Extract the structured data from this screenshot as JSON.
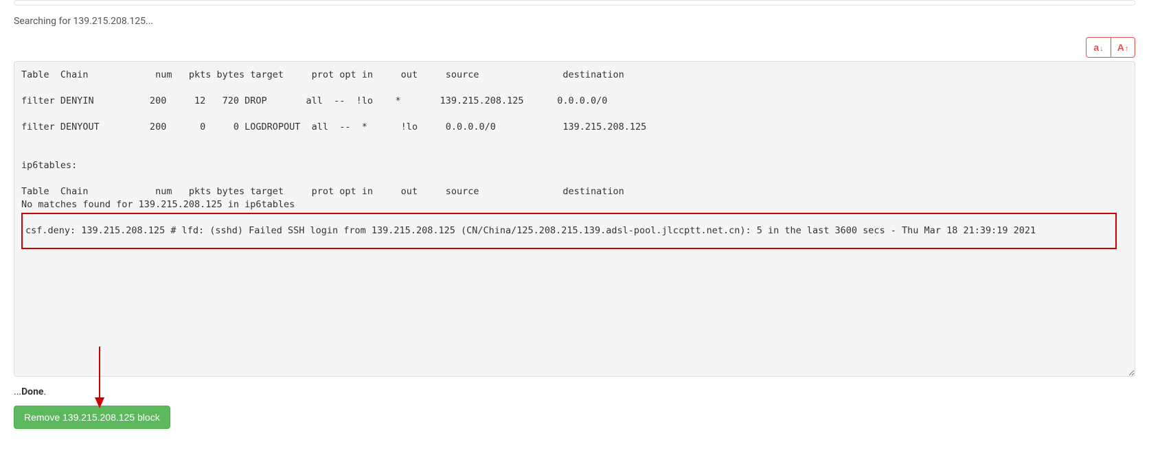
{
  "top": {
    "searching_text": "Searching for 139.215.208.125...",
    "font_decrease_label": "a",
    "font_increase_label": "A"
  },
  "terminal": {
    "line1": "Table  Chain            num   pkts bytes target     prot opt in     out     source               destination",
    "blank1": "",
    "line2": "filter DENYIN          200     12   720 DROP       all  --  !lo    *       139.215.208.125      0.0.0.0/0",
    "blank2": "",
    "line3": "filter DENYOUT         200      0     0 LOGDROPOUT  all  --  *      !lo     0.0.0.0/0            139.215.208.125",
    "blank3": "",
    "blank4": "",
    "line4": "ip6tables:",
    "blank5": "",
    "line5": "Table  Chain            num   pkts bytes target     prot opt in     out     source               destination",
    "line6": "No matches found for 139.215.208.125 in ip6tables",
    "highlight": "csf.deny: 139.215.208.125 # lfd: (sshd) Failed SSH login from 139.215.208.125 (CN/China/125.208.215.139.adsl-pool.jlccptt.net.cn): 5 in the last 3600 secs - Thu Mar 18 21:39:19 2021"
  },
  "done": {
    "prefix": "...",
    "label": "Done",
    "suffix": "."
  },
  "button": {
    "remove_label": "Remove 139.215.208.125 block"
  }
}
